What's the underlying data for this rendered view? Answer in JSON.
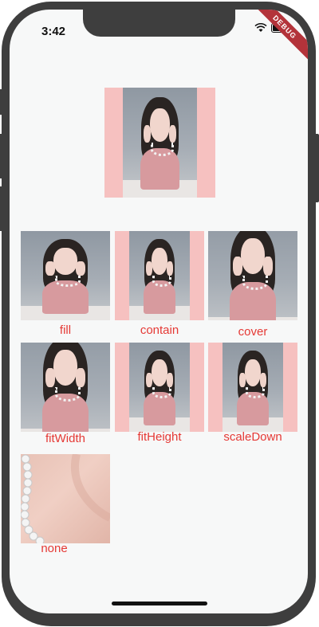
{
  "status_bar": {
    "time": "3:42",
    "banner": "DEBUG",
    "wifi_icon": "wifi-icon",
    "battery_icon": "battery-icon"
  },
  "hero": {
    "image": "portrait-photo"
  },
  "grid": {
    "items": [
      {
        "label": "fill"
      },
      {
        "label": "contain"
      },
      {
        "label": "cover"
      },
      {
        "label": "fitWidth"
      },
      {
        "label": "fitHeight"
      },
      {
        "label": "scaleDown"
      },
      {
        "label": "none"
      }
    ]
  },
  "colors": {
    "label": "#e53935",
    "box_background": "#f6c1c0",
    "page_background": "#f7f8f8",
    "debug_banner": "#b3333a"
  }
}
